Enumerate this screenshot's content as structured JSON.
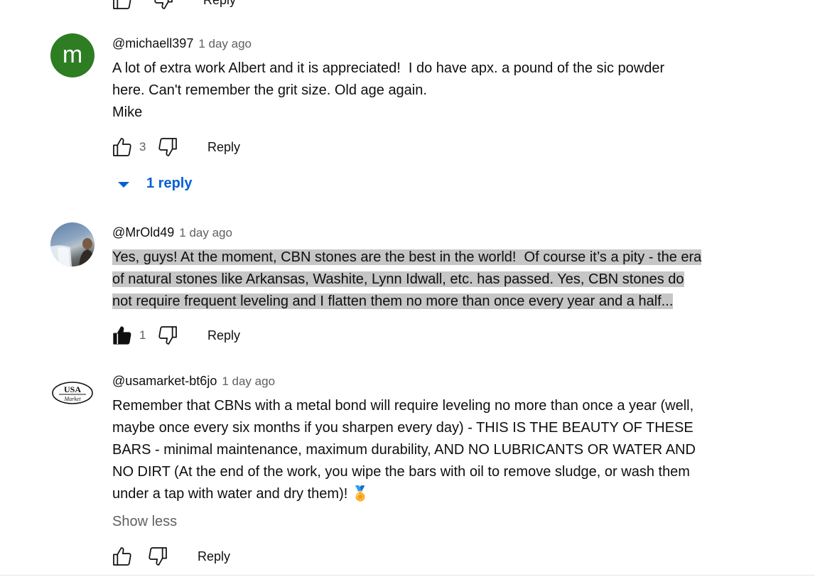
{
  "top_partial": {
    "reply_label": "Reply"
  },
  "comments": [
    {
      "avatar_letter": "m",
      "avatar_color": "#2e7d23",
      "handle": "@michaell397",
      "time": "1 day ago",
      "lines": [
        "A lot of extra work Albert and it is appreciated!  I do have apx. a pound of the sic powder",
        "here. Can't remember the grit size. Old age again.",
        "Mike"
      ],
      "likes": "3",
      "reply_label": "Reply",
      "replies_label": "1 reply"
    },
    {
      "handle": "@MrOld49",
      "time": "1 day ago",
      "lines": [
        "Yes, guys! At the moment, CBN stones are the best in the world!  Of course it’s a pity - the era",
        "of natural stones like Arkansas, Washite, Lynn Idwall, etc. has passed. Yes, CBN stones do",
        "not require frequent leveling and I flatten them no more than once every year and a half..."
      ],
      "likes": "1",
      "reply_label": "Reply"
    },
    {
      "avatar_logo_top": "USA",
      "avatar_logo_bottom": "Market",
      "handle": "@usamarket-bt6jo",
      "time": "1 day ago",
      "lines": [
        "Remember that CBNs with a metal bond will require leveling no more than once a year (well,",
        "maybe once every six months if you sharpen every day) - THIS IS THE BEAUTY OF THESE",
        "BARS - minimal maintenance, maximum durability, AND NO LUBRICANTS OR WATER AND",
        "NO DIRT (At the end of the work, you wipe the bars with oil to remove sludge, or wash them",
        "under a tap with water and dry them)! 🏅"
      ],
      "show_less": "Show less",
      "reply_label": "Reply"
    }
  ],
  "icons": {
    "like": "thumbs-up-icon",
    "dislike": "thumbs-down-icon",
    "expand": "caret-down-icon"
  },
  "colors": {
    "link_blue": "#065fd4",
    "highlight": "#c6c6c6",
    "meta_gray": "#606060"
  }
}
